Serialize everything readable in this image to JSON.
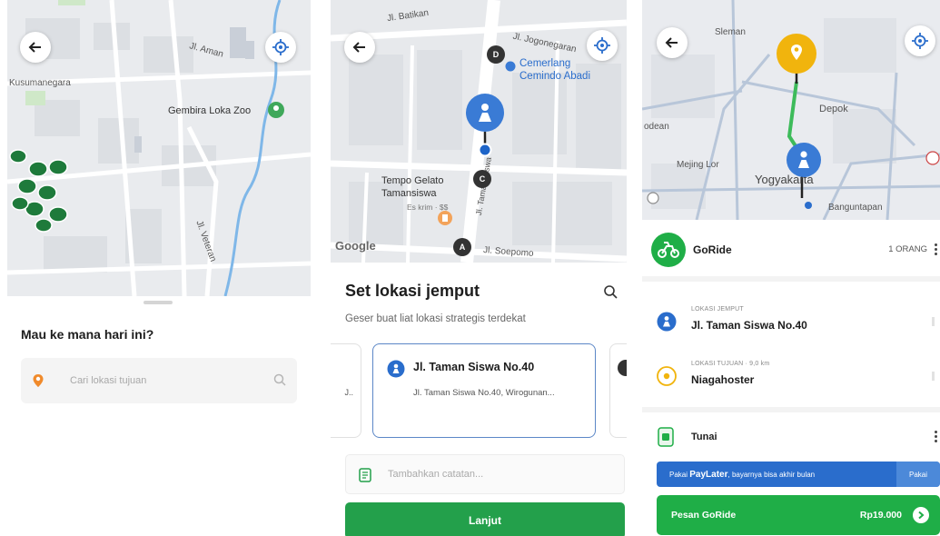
{
  "screen1": {
    "map_labels": [
      "Jl. Aman",
      "Kusumanegara",
      "Gembira Loka Zoo",
      "Jl. Veteran"
    ],
    "sheet_title": "Mau ke mana hari ini?",
    "search_placeholder": "Cari lokasi tujuan"
  },
  "screen2": {
    "map_labels": [
      "Jl. Batikan",
      "Jl. Jogonegaran",
      "Cemerlang\nCemindo Abadi",
      "Jl. Taman Siswa",
      "Tempo Gelato\nTamansiswa",
      "Es krim · $$",
      "Jl. Soepomo"
    ],
    "markers": [
      "D",
      "C",
      "A"
    ],
    "google_logo": "Google",
    "title": "Set lokasi jemput",
    "subtitle": "Geser buat liat lokasi strategis terdekat",
    "card_name": "Jl. Taman Siswa No.40",
    "card_address": "Jl. Taman Siswa No.40, Wirogunan...",
    "left_card_fragment": "J..",
    "note_placeholder": "Tambahkan catatan...",
    "continue_label": "Lanjut"
  },
  "screen3": {
    "map_labels": [
      "Sleman",
      "Depok",
      "odean",
      "Mejing Lor",
      "Yogyakarta",
      "Banguntapan"
    ],
    "service_name": "GoRide",
    "passenger_count": "1 ORANG",
    "pickup_label": "LOKASI JEMPUT",
    "pickup_value": "Jl. Taman Siswa No.40",
    "destination_label": "LOKASI TUJUAN · 9,0 km",
    "destination_value": "Niagahoster",
    "payment_method": "Tunai",
    "paylater_prefix": "Pakai",
    "paylater_brand": "PayLater",
    "paylater_suffix": ", bayarnya bisa akhir bulan",
    "paylater_button": "Pakai",
    "order_label": "Pesan GoRide",
    "order_price": "Rp19.000"
  },
  "colors": {
    "gojek_green": "#1fae47",
    "pickup_blue": "#2a6dcc",
    "destination_yellow": "#f1b40d",
    "route_blue": "#3b82c4"
  }
}
